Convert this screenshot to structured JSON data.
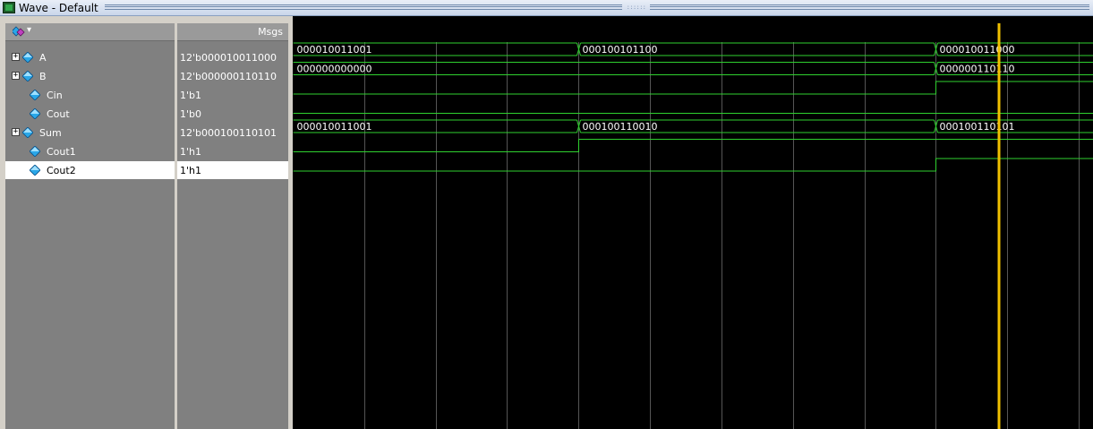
{
  "window": {
    "title": "Wave - Default"
  },
  "header": {
    "msgs_label": "Msgs"
  },
  "signals": [
    {
      "name": "A",
      "value": "12'b000010011000",
      "expandable": true,
      "kind": "bus"
    },
    {
      "name": "B",
      "value": "12'b000000110110",
      "expandable": true,
      "kind": "bus"
    },
    {
      "name": "Cin",
      "value": "1'b1",
      "expandable": false,
      "kind": "bit"
    },
    {
      "name": "Cout",
      "value": "1'b0",
      "expandable": false,
      "kind": "bit"
    },
    {
      "name": "Sum",
      "value": "12'b000100110101",
      "expandable": true,
      "kind": "bus"
    },
    {
      "name": "Cout1",
      "value": "1'h1",
      "expandable": false,
      "kind": "bit"
    },
    {
      "name": "Cout2",
      "value": "1'h1",
      "expandable": false,
      "kind": "bit",
      "selected": true
    }
  ],
  "waveforms": {
    "A": [
      {
        "t": 0,
        "v": "000010011001"
      },
      {
        "t": 2,
        "v": "000100101100"
      },
      {
        "t": 4.5,
        "v": "000010011000"
      }
    ],
    "B": [
      {
        "t": 0,
        "v": "000000000000"
      },
      {
        "t": 4.5,
        "v": "000000110110"
      }
    ],
    "Cin": [
      {
        "t": 0,
        "v": 0
      },
      {
        "t": 4.5,
        "v": 1
      }
    ],
    "Cout": [
      {
        "t": 0,
        "v": 0
      }
    ],
    "Sum": [
      {
        "t": 0,
        "v": "000010011001"
      },
      {
        "t": 2,
        "v": "000100110010"
      },
      {
        "t": 4.5,
        "v": "000100110101"
      }
    ],
    "Cout1": [
      {
        "t": 0,
        "v": 0
      },
      {
        "t": 2,
        "v": 1
      }
    ],
    "Cout2": [
      {
        "t": 0,
        "v": 0
      },
      {
        "t": 4.5,
        "v": 1
      }
    ]
  },
  "time_span": 5.6,
  "cursor_time": 4.94,
  "colors": {
    "wave": "#2fd12f",
    "cursor": "#f0c000",
    "grid": "#555555",
    "background": "#000000",
    "pane": "#808080",
    "diamond": "#2aa7e8"
  },
  "icons": {
    "header": "wave-window-icon",
    "signal": "diamond-icon",
    "expand": "plus-icon"
  }
}
